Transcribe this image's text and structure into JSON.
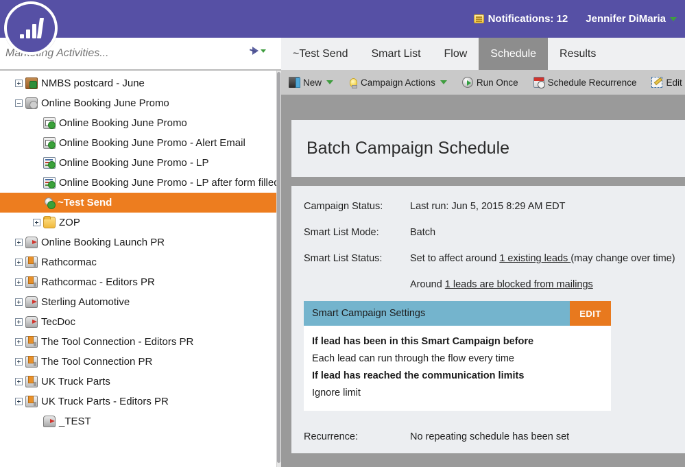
{
  "header": {
    "logo_name": "marketo-logo",
    "notifications_label": "Notifications: 12",
    "user_name": "Jennifer DiMaria"
  },
  "sidebar": {
    "search_placeholder": "Marketing Activities...",
    "search_value": "",
    "tree": [
      {
        "label": "NMBS postcard - June",
        "indent": 0,
        "toggle": "plus",
        "icon": "program-icon"
      },
      {
        "label": "Online Booking June Promo",
        "indent": 0,
        "toggle": "minus",
        "icon": "engagement-icon"
      },
      {
        "label": "Online Booking June Promo",
        "indent": 1,
        "toggle": "none",
        "icon": "email-icon"
      },
      {
        "label": "Online Booking June Promo - Alert Email",
        "indent": 1,
        "toggle": "none",
        "icon": "email-icon"
      },
      {
        "label": "Online Booking June Promo - LP",
        "indent": 1,
        "toggle": "none",
        "icon": "landing-page-icon"
      },
      {
        "label": "Online Booking June Promo - LP after form filled out",
        "indent": 1,
        "toggle": "none",
        "icon": "landing-page-icon"
      },
      {
        "label": "~Test Send",
        "indent": 1,
        "toggle": "none",
        "icon": "smart-campaign-icon",
        "selected": true
      },
      {
        "label": "ZOP",
        "indent": 1,
        "toggle": "plus",
        "icon": "folder-icon"
      },
      {
        "label": "Online Booking Launch PR",
        "indent": 0,
        "toggle": "plus",
        "icon": "mailbox-icon"
      },
      {
        "label": "Rathcormac",
        "indent": 0,
        "toggle": "plus",
        "icon": "books-icon"
      },
      {
        "label": "Rathcormac - Editors PR",
        "indent": 0,
        "toggle": "plus",
        "icon": "books-icon"
      },
      {
        "label": "Sterling Automotive",
        "indent": 0,
        "toggle": "plus",
        "icon": "mailbox-icon"
      },
      {
        "label": "TecDoc",
        "indent": 0,
        "toggle": "plus",
        "icon": "mailbox-icon"
      },
      {
        "label": "The Tool Connection - Editors PR",
        "indent": 0,
        "toggle": "plus",
        "icon": "books-icon"
      },
      {
        "label": "The Tool Connection PR",
        "indent": 0,
        "toggle": "plus",
        "icon": "books-icon"
      },
      {
        "label": "UK Truck Parts",
        "indent": 0,
        "toggle": "plus",
        "icon": "books-icon"
      },
      {
        "label": "UK Truck Parts - Editors PR",
        "indent": 0,
        "toggle": "plus",
        "icon": "books-icon"
      },
      {
        "label": "_TEST",
        "indent": 1,
        "toggle": "none",
        "icon": "mailbox-icon"
      }
    ]
  },
  "tabs": [
    {
      "label": "~Test Send",
      "active": false
    },
    {
      "label": "Smart List",
      "active": false
    },
    {
      "label": "Flow",
      "active": false
    },
    {
      "label": "Schedule",
      "active": true
    },
    {
      "label": "Results",
      "active": false
    }
  ],
  "toolbar": {
    "group1": [
      {
        "label": "New",
        "icon": "new-icon",
        "caret": true
      },
      {
        "label": "Campaign Actions",
        "icon": "lightbulb-icon",
        "caret": true
      }
    ],
    "group2": [
      {
        "label": "Run Once",
        "icon": "play-icon",
        "caret": false
      },
      {
        "label": "Schedule Recurrence",
        "icon": "calendar-icon",
        "caret": false
      },
      {
        "label": "Edit",
        "icon": "pencil-icon",
        "caret": false
      }
    ]
  },
  "main": {
    "page_title": "Batch Campaign Schedule",
    "campaign_status_label": "Campaign Status:",
    "campaign_status_value": "Last run: Jun 5, 2015 8:29 AM EDT",
    "smart_list_mode_label": "Smart List Mode:",
    "smart_list_mode_value": "Batch",
    "smart_list_status_label": "Smart List Status:",
    "smart_list_status_prefix": "Set to affect around ",
    "smart_list_status_link": "1 existing leads ",
    "smart_list_status_suffix": "(may change over time)",
    "blocked_prefix": "Around ",
    "blocked_link": "1 leads are blocked from mailings",
    "settings": {
      "title": "Smart Campaign Settings",
      "edit_label": "EDIT",
      "rows": [
        {
          "text": "If lead has been in this Smart Campaign before",
          "bold": true
        },
        {
          "text": "Each lead can run through the flow every time",
          "bold": false
        },
        {
          "text": "If lead has reached the communication limits",
          "bold": true
        },
        {
          "text": "Ignore limit",
          "bold": false
        }
      ]
    },
    "recurrence_label": "Recurrence:",
    "recurrence_value": "No repeating schedule has been set"
  },
  "colors": {
    "brand_purple": "#5650a5",
    "accent_orange": "#ee7623",
    "selected_orange": "#ed7d1f",
    "settings_blue": "#74b4cd",
    "edit_orange": "#e8791e",
    "panel_bg": "#eceef1",
    "main_bg": "#9a9a9a",
    "toolbar_bg": "#c9c9c9",
    "tab_bg": "#eff0f2",
    "tab_active_bg": "#8d8d8d"
  }
}
